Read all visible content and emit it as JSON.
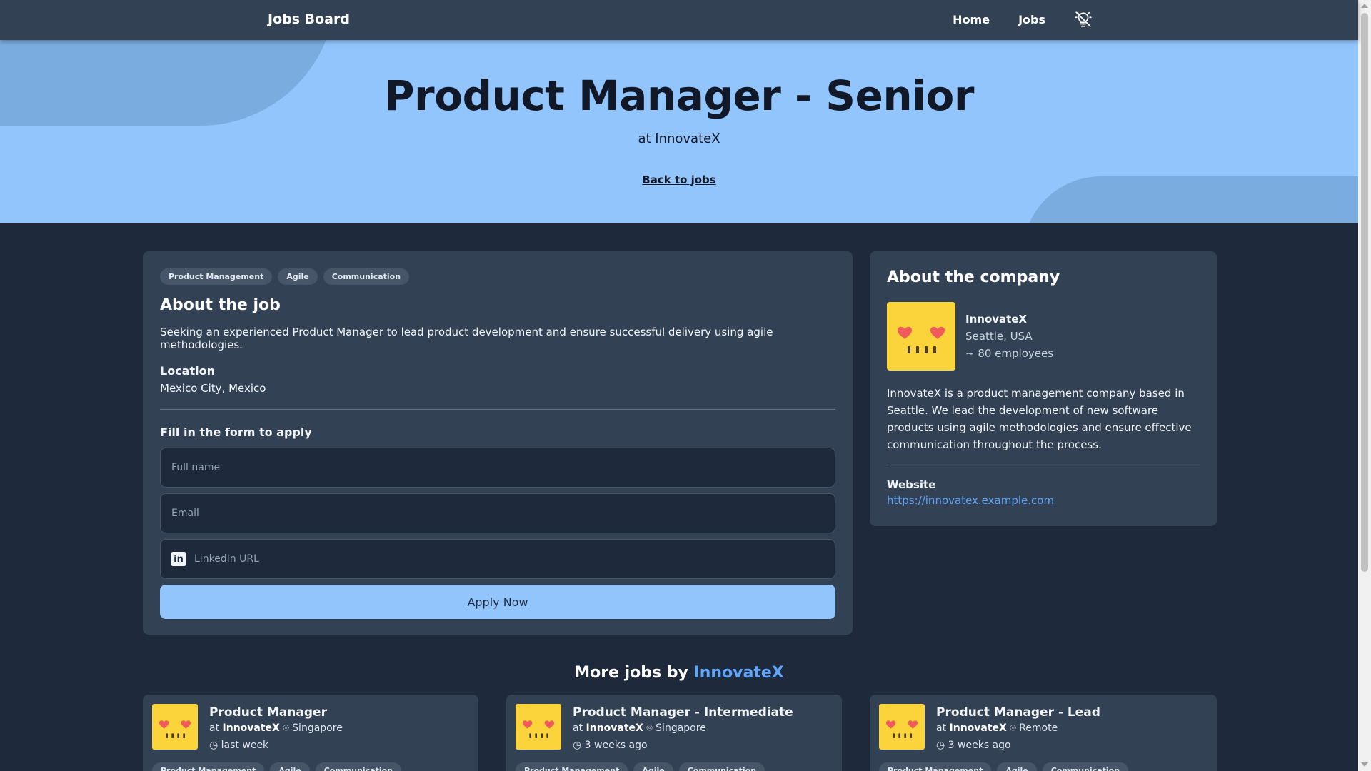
{
  "header": {
    "brand": "Jobs Board",
    "nav": [
      "Home",
      "Jobs"
    ],
    "theme_icon": "lightbulb-off-icon"
  },
  "hero": {
    "title": "Product Manager - Senior",
    "subtitle": "at InnovateX",
    "back_link": "Back to jobs"
  },
  "job": {
    "tags": [
      "Product Management",
      "Agile",
      "Communication"
    ],
    "heading": "About the job",
    "description": "Seeking an experienced Product Manager to lead product development and ensure successful delivery using agile methodologies.",
    "location_label": "Location",
    "location": "Mexico City, Mexico",
    "form_title": "Fill in the form to apply",
    "form": {
      "name_placeholder": "Full name",
      "email_placeholder": "Email",
      "linkedin_placeholder": "LinkedIn URL",
      "apply_label": "Apply Now"
    }
  },
  "company": {
    "heading": "About the company",
    "name": "InnovateX",
    "location": "Seattle, USA",
    "employees": "~ 80 employees",
    "about": "InnovateX is a product management company based in Seattle. We lead the development of new software products using agile methodologies and ensure effective communication throughout the process.",
    "website_label": "Website",
    "website": "https://innovatex.example.com",
    "logo_color": "#fbd43b",
    "heart_color": "#f05a5a"
  },
  "more": {
    "title_prefix": "More jobs by",
    "title_company": "InnovateX",
    "jobs": [
      {
        "title": "Product Manager",
        "at": "at",
        "company": "InnovateX",
        "location": "Singapore",
        "posted": "last week",
        "tags": [
          "Product Management",
          "Agile",
          "Communication"
        ]
      },
      {
        "title": "Product Manager - Intermediate",
        "at": "at",
        "company": "InnovateX",
        "location": "Singapore",
        "posted": "3 weeks ago",
        "tags": [
          "Product Management",
          "Agile",
          "Communication"
        ]
      },
      {
        "title": "Product Manager - Lead",
        "at": "at",
        "company": "InnovateX",
        "location": "Remote",
        "posted": "3 weeks ago",
        "tags": [
          "Product Management",
          "Agile",
          "Communication"
        ]
      }
    ]
  },
  "colors": {
    "page_bg": "#1e293b",
    "card_bg": "#334155",
    "hero_bg": "#93c5fd",
    "accent": "#60a5fa"
  }
}
